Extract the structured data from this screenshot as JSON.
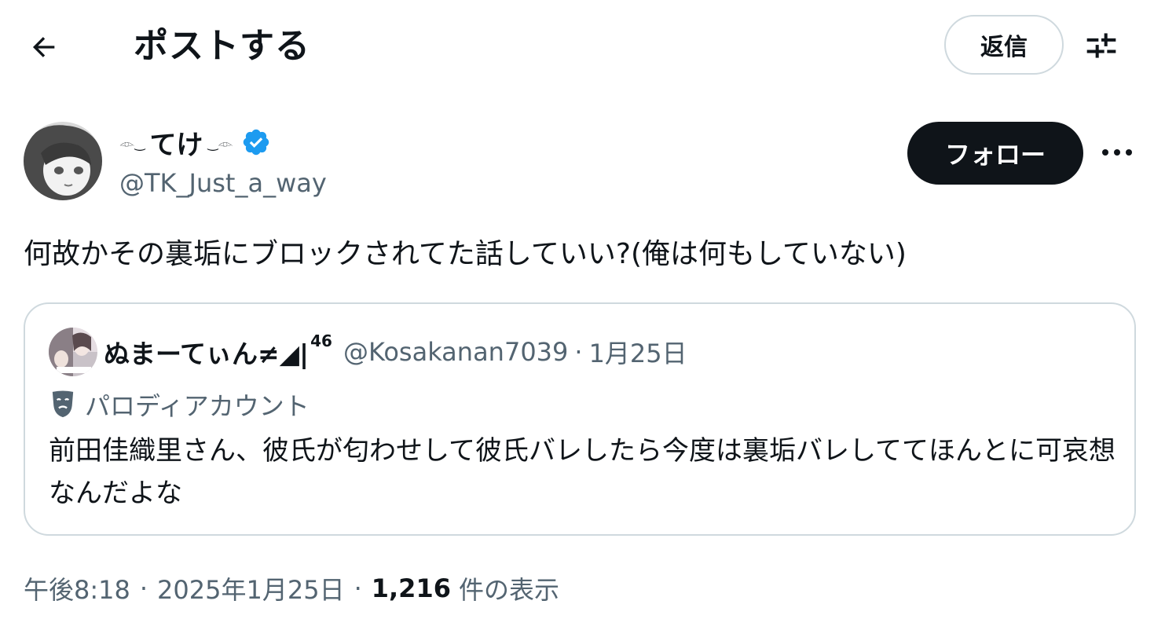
{
  "header": {
    "back_icon": "arrow-left-icon",
    "title": "ポストする",
    "reply_label": "返信",
    "filter_icon": "sliders-icon"
  },
  "author": {
    "display_name": "てけ",
    "name_decoration_left": "𓁹‿",
    "name_decoration_right": "‿𓁹",
    "verified_color": "#1d9bf0",
    "handle": "@TK_Just_a_way",
    "follow_label": "フォロー",
    "more_icon": "more-horizontal-icon"
  },
  "post": {
    "text": "何故かその裏垢にブロックされてた話していい?(俺は何もしていない)"
  },
  "quote": {
    "display_name": "ぬまーてぃん≠◢|",
    "name_superscript": "46",
    "handle": "@Kosakanan7039",
    "separator": "·",
    "date": "1月25日",
    "parody_icon": "theater-mask-icon",
    "parody_label": "パロディアカウント",
    "text": "前田佳織里さん、彼氏が匂わせして彼氏バレしたら今度は裏垢バレしててほんとに可哀想なんだよな"
  },
  "meta": {
    "time": "午後8:18",
    "separator": "·",
    "date": "2025年1月25日",
    "views_count": "1,216",
    "views_label": "件の表示"
  },
  "colors": {
    "text_primary": "#0f1419",
    "text_secondary": "#536471",
    "border": "#cfd9de",
    "follow_bg": "#0f1419",
    "verified": "#1d9bf0"
  }
}
